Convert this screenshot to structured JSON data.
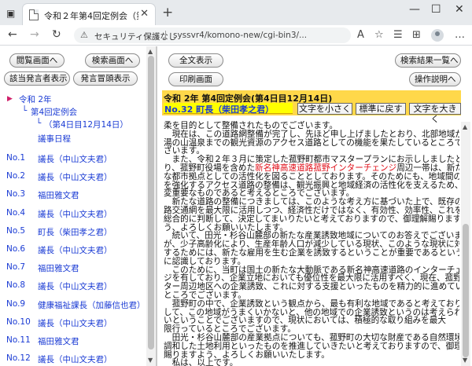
{
  "browser": {
    "tab_title": "令和２年第4回定例会（第4日目）",
    "security_label": "セキュリティ保護なし",
    "url": "syssvr4/komono-new/cgi-bin3/..."
  },
  "left": {
    "buttons": {
      "first": "閲覧画面へ",
      "search": "検索画面へ",
      "speakers": "該当発言者表示",
      "list": "発言冒頭表示"
    },
    "tree": {
      "year": "令和 2年",
      "session": "第4回定例会",
      "day": "（第4日目12月14日）",
      "agenda": "議事日程"
    },
    "rows": [
      {
        "no": "No.1",
        "speaker": "議長（中山文夫君）"
      },
      {
        "no": "No.2",
        "speaker": "議長（中山文夫君）"
      },
      {
        "no": "No.3",
        "speaker": "福田雅文君"
      },
      {
        "no": "No.4",
        "speaker": "議長（中山文夫君）"
      },
      {
        "no": "No.5",
        "speaker": "町長（柴田孝之君）"
      },
      {
        "no": "No.6",
        "speaker": "議長（中山文夫君）"
      },
      {
        "no": "No.7",
        "speaker": "福田雅文君"
      },
      {
        "no": "No.8",
        "speaker": "議長（中山文夫君）"
      },
      {
        "no": "No.9",
        "speaker": "健康福祉課長（加藤信也君）"
      },
      {
        "no": "No.10",
        "speaker": "議長（中山文夫君）"
      },
      {
        "no": "No.11",
        "speaker": "福田雅文君"
      },
      {
        "no": "No.12",
        "speaker": "議長（中山文夫君）"
      }
    ]
  },
  "right": {
    "buttons": {
      "show_all": "全文表示",
      "print": "印刷画面",
      "back_to_results": "検索結果一覧へ",
      "help": "操作説明へ"
    },
    "header_date": "令和 2年 第4回定例会(第4日目12月14日)",
    "header_speaker": "No.32 町長（柴田孝之君）",
    "size_buttons": {
      "smaller": "文字を小さく",
      "reset": "標準に戻す",
      "larger": "文字を大きく"
    },
    "body_lines": [
      {
        "pre": "柔を目的として整備されたものでございます。",
        "red": "",
        "post": ""
      },
      {
        "pre": "　現在は、この道路網整備が完了し、先ほど申し上げましたとおり、北部地域から",
        "red": "",
        "post": ""
      },
      {
        "pre": "湯の山温泉までの観光資源のアクセス道路としての機能を果たしているところでご",
        "red": "",
        "post": ""
      },
      {
        "pre": "ざいます。",
        "red": "",
        "post": ""
      },
      {
        "pre": "　また、令和２年３月に策定した菰野町都市マスタープランにお示ししましたとお",
        "red": "",
        "post": ""
      },
      {
        "pre": "り、菰野町役場を含めた",
        "red": "新名神高速道路菰野インターチェンジ",
        "post": "周辺一帯は、新た"
      },
      {
        "pre": "な都市拠点としての活性化を図ることとしております。そのためにも、地域間の連携",
        "red": "",
        "post": ""
      },
      {
        "pre": "を強化するアクセス道路の整備は、観光振興と地域経済の活性化を支えるため、大",
        "red": "",
        "post": ""
      },
      {
        "pre": "変重要なものであると考えるところでございます。",
        "red": "",
        "post": ""
      },
      {
        "pre": "　新たな道路の整備につきましては、このような考え方に基づいた上で、既存の道",
        "red": "",
        "post": ""
      },
      {
        "pre": "路交通網を最大限に活用しつつ、経済性だけではなく、有効性、効率性、これを",
        "red": "",
        "post": ""
      },
      {
        "pre": "総合的に判断して、決定してまいりたいと考えておりますので、御理解賜りますよ",
        "red": "",
        "post": ""
      },
      {
        "pre": "う、よろしくお願いいたします。",
        "red": "",
        "post": ""
      },
      {
        "pre": "　続いて、田光・杉谷山麓部の新たな産業誘致地域についてのお答えでございます",
        "red": "",
        "post": ""
      },
      {
        "pre": "が、少子高齢化により、生産年齢人口が減少している現状、このような現状に対応",
        "red": "",
        "post": ""
      },
      {
        "pre": "するためには、新たな雇用を生む企業を誘致するということが重要であるというふう",
        "red": "",
        "post": ""
      },
      {
        "pre": "に認識しております。",
        "red": "",
        "post": ""
      },
      {
        "pre": "　このために、当町は国土の新たな大動脈である新名神高速道路のインターチェン",
        "red": "",
        "post": ""
      },
      {
        "pre": "ジを有しており、企業立地においても優位性を最大限に活用すべく、現在、菰野イン",
        "red": "",
        "post": ""
      },
      {
        "pre": "ター周辺地区への企業誘致、これに対する支援といったものを精力的に進めている",
        "red": "",
        "post": ""
      },
      {
        "pre": "ところでございます。",
        "red": "",
        "post": ""
      },
      {
        "pre": "　菰野町の中で、企業誘致という観点から、最も有利な地域であると考えております",
        "red": "",
        "post": ""
      },
      {
        "pre": "して、この地域がうまくいかないと、他の地域での企業誘致というのは考えられな",
        "red": "",
        "post": ""
      },
      {
        "pre": "いということでございますので、現状においては、積極的な取り組みを最大",
        "red": "",
        "post": ""
      },
      {
        "pre": "限行っているところでございます。",
        "red": "",
        "post": ""
      },
      {
        "pre": "　田光・杉谷山麓部の産業拠点についても、菰野町の大切な財産である自然環境と",
        "red": "",
        "post": ""
      },
      {
        "pre": "調和した土地利用といったものを推進していきたいと考えておりますので、御理解",
        "red": "",
        "post": ""
      },
      {
        "pre": "賜りますよう、よろしくお願いいたします。",
        "red": "",
        "post": ""
      },
      {
        "pre": "　私は、以上です。",
        "red": "",
        "post": ""
      }
    ]
  }
}
